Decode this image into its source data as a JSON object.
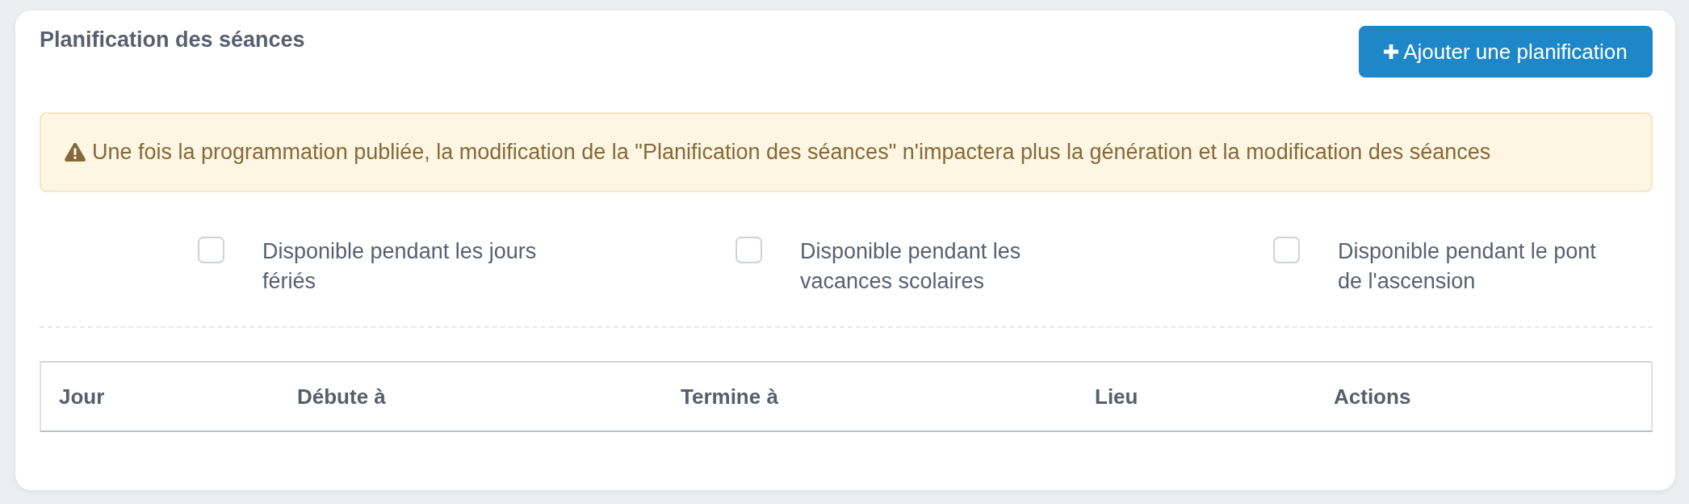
{
  "card": {
    "title": "Planification des séances",
    "add_button": {
      "label": "Ajouter une planification"
    }
  },
  "alert": {
    "text": "Une fois la programmation publiée, la modification de la \"Planification des séances\" n'impactera plus la génération et la modification des séances"
  },
  "options": [
    {
      "label": "Disponible pendant les jours fériés",
      "checked": false
    },
    {
      "label": "Disponible pendant les vacances scolaires",
      "checked": false
    },
    {
      "label": "Disponible pendant le pont de l'ascension",
      "checked": false
    }
  ],
  "table": {
    "columns": [
      "Jour",
      "Débute à",
      "Termine à",
      "Lieu",
      "Actions"
    ]
  }
}
